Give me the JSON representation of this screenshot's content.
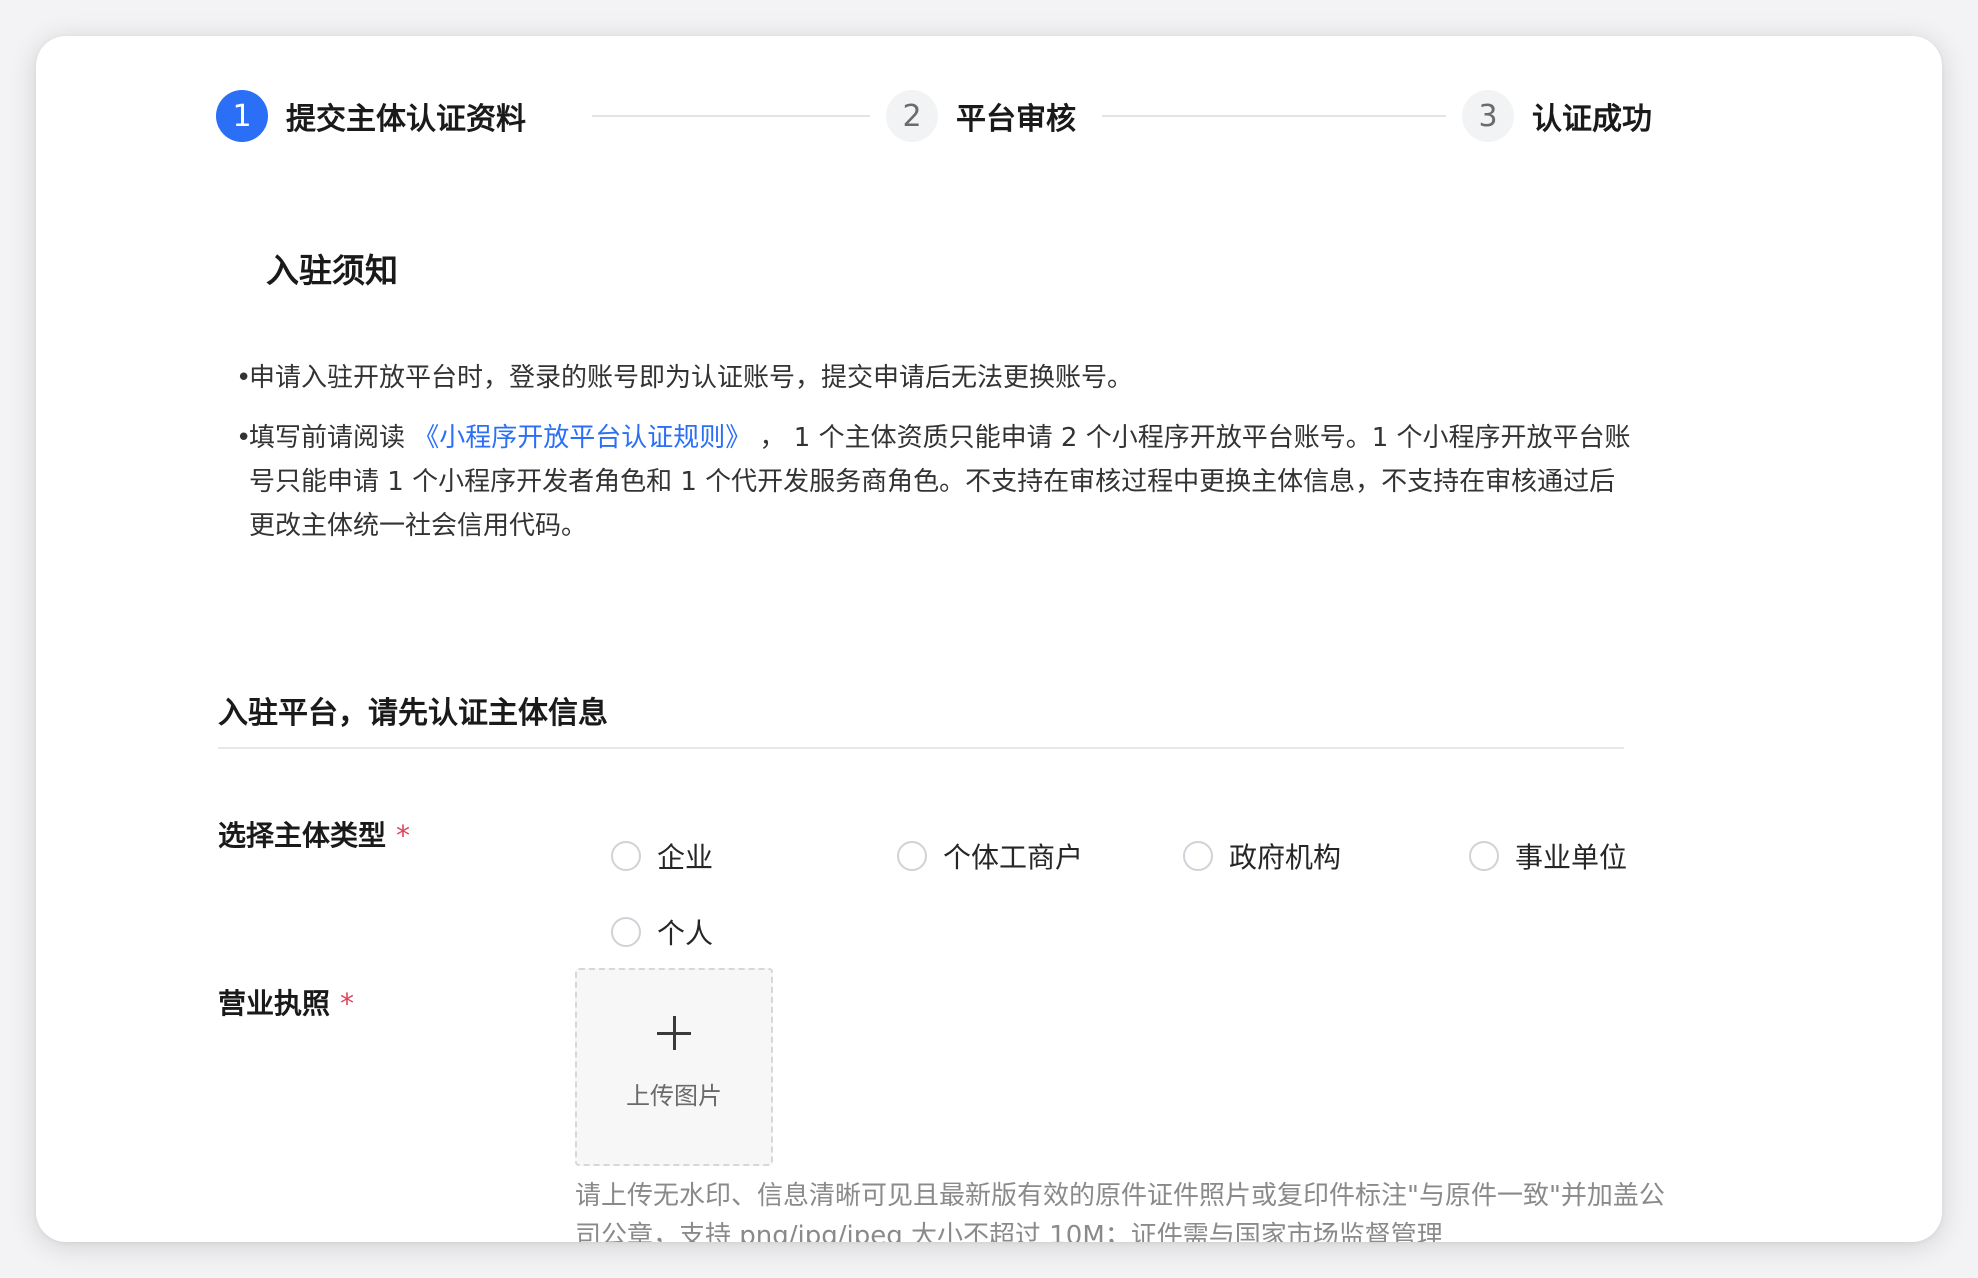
{
  "stepper": {
    "steps": [
      {
        "number": "1",
        "label": "提交主体认证资料",
        "state": "active"
      },
      {
        "number": "2",
        "label": "平台审核",
        "state": "inactive"
      },
      {
        "number": "3",
        "label": "认证成功",
        "state": "inactive"
      }
    ]
  },
  "notice": {
    "title": "入驻须知",
    "bullet": "•",
    "item1": "申请入驻开放平台时，登录的账号即为认证账号，提交申请后无法更换账号。",
    "item2_prefix": "填写前请阅读 ",
    "item2_link": "《小程序开放平台认证规则》",
    "item2_suffix": " ， 1 个主体资质只能申请 2 个小程序开放平台账号。1 个小程序开放平台账号只能申请 1 个小程序开发者角色和 1 个代开发服务商角色。不支持在审核过程中更换主体信息，不支持在审核通过后更改主体统一社会信用代码。"
  },
  "form": {
    "section_title": "入驻平台，请先认证主体信息",
    "required_mark": "*",
    "entity_type": {
      "label": "选择主体类型",
      "options": [
        "企业",
        "个体工商户",
        "政府机构",
        "事业单位",
        "个人"
      ]
    },
    "license": {
      "label": "营业执照",
      "upload_label": "上传图片",
      "hint": "请上传无水印、信息清晰可见且最新版有效的原件证件照片或复印件标注\"与原件一致\"并加盖公司公章，支持 png/jpg/jpeg 大小不超过 10M；证件需与国家市场监督管理"
    }
  },
  "colors": {
    "accent": "#2a6ff6",
    "required": "#e0425a"
  }
}
